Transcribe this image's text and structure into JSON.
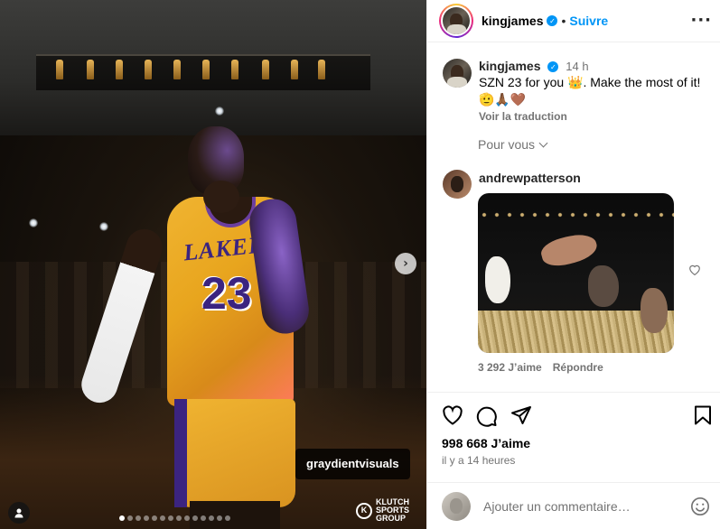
{
  "media": {
    "tag": "graydientvisuals",
    "brand_line1": "KLUTCH",
    "brand_line2": "SPORTS",
    "brand_line3": "GROUP",
    "jersey_team": "LAKERS",
    "jersey_number": "23",
    "carousel_total": 14,
    "carousel_active": 0
  },
  "header": {
    "username": "kingjames",
    "follow_label": "Suivre",
    "more_label": "···"
  },
  "caption": {
    "username": "kingjames",
    "time": "14 h",
    "text": "SZN 23 for you 👑. Make the most of it! 🫡🙏🏾🤎",
    "translate_label": "Voir la traduction",
    "for_you_label": "Pour vous"
  },
  "comment": {
    "username": "andrewpatterson",
    "likes": "3 292 J’aime",
    "reply_label": "Répondre"
  },
  "actions": {
    "likes": "998 668 J’aime",
    "time_ago": "il y a 14 heures"
  },
  "composer": {
    "placeholder": "Ajouter un commentaire…"
  },
  "colors": {
    "accent": "#0095f6",
    "lakers_gold": "#f0b431",
    "lakers_purple": "#3b2480"
  }
}
